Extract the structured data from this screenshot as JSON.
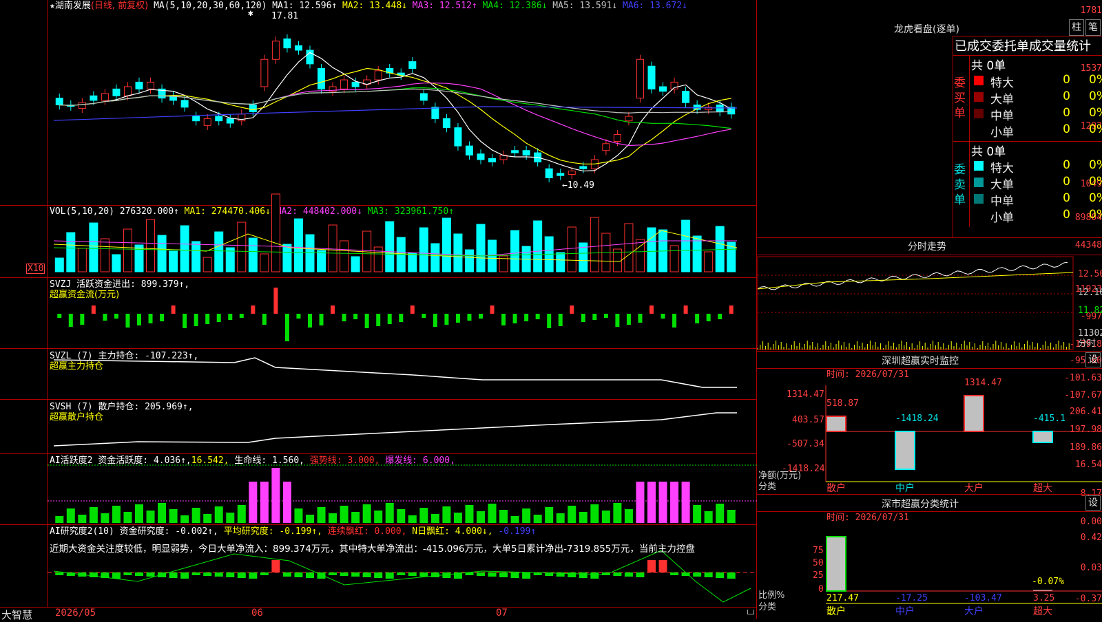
{
  "colors": {
    "up": "#ff3030",
    "down": "#00ffff",
    "grid": "#b00000",
    "yellow": "#ffff00",
    "magenta": "#ff40ff",
    "green": "#00e000",
    "blue": "#4040ff",
    "white": "#ffffff",
    "axis": "#ff4040"
  },
  "main": {
    "star": "★",
    "stock_name": "湖南发展",
    "period": "(日线, 前复权)",
    "ma_header": "MA(5,10,20,30,60,120)",
    "ma1": "MA1: 12.596↑",
    "ma2": "MA2: 13.448↓",
    "ma3": "MA3: 12.512↑",
    "ma4": "MA4: 12.386↓",
    "ma5": "MA5: 13.591↓",
    "ma6": "MA6: 13.672↓",
    "y_labels": [
      "1781",
      "1537",
      "1293",
      "1049"
    ],
    "high_label": "17.81",
    "low_label": "←10.49",
    "top_marker": "✱"
  },
  "vol": {
    "header": "VOL(5,10,20)",
    "value": "276320.000↑",
    "ma1": "MA1: 274470.406↓",
    "ma2": "MA2: 448402.000↓",
    "ma3": "MA3: 323961.750↑",
    "y_labels": [
      "89804",
      "44348"
    ],
    "unit": "X10"
  },
  "svzj": {
    "header": "SVZJ  活跃资金进出: 899.379↑,",
    "sub": "超赢资金流(万元)",
    "y_labels": [
      "11923",
      "-997",
      "-13918"
    ]
  },
  "svzl": {
    "header": "SVZL (7) 主力持仓: -107.223↑,",
    "sub": "超赢主力持仓",
    "y_labels": [
      "-95.60",
      "-101.63",
      "-107.67"
    ]
  },
  "svsh": {
    "header": "SVSH (7) 散户持仓: 205.969↑,",
    "sub": "超赢散户持仓",
    "y_labels": [
      "206.41",
      "197.98",
      "189.86"
    ]
  },
  "ai_active": {
    "header": "AI活跃度2 资金活跃度: 4.036↑,",
    "v2": "16.542,",
    "life": "生命线: 1.560,",
    "strong": "强势线: 3.000,",
    "burst": "爆发线: 6.000,",
    "y_labels": [
      "16.54",
      "8.17",
      "0.00"
    ]
  },
  "ai_research": {
    "header": "AI研究度2(10) 资金研究度: -0.002↑,",
    "avg": "平均研究度: -0.199↑,",
    "red": "连续飘红: 0.000,",
    "nred": "N日飘红: 4.000↓,",
    "last": "-0.199↑",
    "comment": "近期大资金关注度较低，明显弱势，今日大单净流入：899.374万元，其中特大单净流出：-415.096万元，大单5日累计净出-7319.855万元，当前主力控盘",
    "y_labels": [
      "0.42",
      "0.03",
      "-0.37"
    ]
  },
  "xaxis": {
    "labels": [
      "2026/05",
      "06",
      "07"
    ],
    "brand": "大智慧"
  },
  "right": {
    "lhb_title": "龙虎看盘(逐单)",
    "btn_zhu": "柱",
    "btn_bi": "笔",
    "stat_title": "已成交委托单成交量统计",
    "buy_label": "委买单",
    "sell_label": "委卖单",
    "buy_total": "共 0单",
    "sell_total": "共 0单",
    "buy_rows": [
      {
        "label": "特大",
        "v": "0",
        "p": "0%",
        "color": "#ff0000"
      },
      {
        "label": "大单",
        "v": "0",
        "p": "0%",
        "color": "#990000"
      },
      {
        "label": "中单",
        "v": "0",
        "p": "0%",
        "color": "#660000"
      },
      {
        "label": "小单",
        "v": "0",
        "p": "0%",
        "color": "#000000"
      }
    ],
    "sell_rows": [
      {
        "label": "特大",
        "v": "0",
        "p": "0%",
        "color": "#00ffff"
      },
      {
        "label": "大单",
        "v": "0",
        "p": "0%",
        "color": "#009999"
      },
      {
        "label": "中单",
        "v": "0",
        "p": "0%",
        "color": "#007777"
      },
      {
        "label": "小单",
        "v": "0",
        "p": "0%",
        "color": "#000000"
      }
    ],
    "fs_title": "分时走势",
    "fs_labels": [
      "12.50",
      "12.16",
      "11.82",
      "11302"
    ],
    "fs_time_label": "分时",
    "mon_title": "深圳超赢实时监控",
    "mon_btn": "设",
    "mon_time": "时间: 2026/07/31",
    "mon_y": [
      "1314.47",
      "403.57",
      "-507.34",
      "-1418.24"
    ],
    "mon_ylabel": "净额(万元)",
    "mon_xlabel": "分类",
    "mon_cats": [
      "散户",
      "中户",
      "大户",
      "超大"
    ],
    "mon_vals": [
      "518.87",
      "-1418.24",
      "1314.47",
      "-415.1"
    ],
    "cls_title": "深市超赢分类统计",
    "cls_btn": "设",
    "cls_time": "时间: 2026/07/31",
    "cls_y": [
      "75",
      "50",
      "25",
      "0"
    ],
    "cls_ylabel": "比例%",
    "cls_xlabel": "分类",
    "cls_cats": [
      "散户",
      "中户",
      "大户",
      "超大"
    ],
    "cls_vals": [
      "217.47",
      "-17.25",
      "-103.47",
      "3.25"
    ],
    "cls_note": "-0.07%"
  }
}
